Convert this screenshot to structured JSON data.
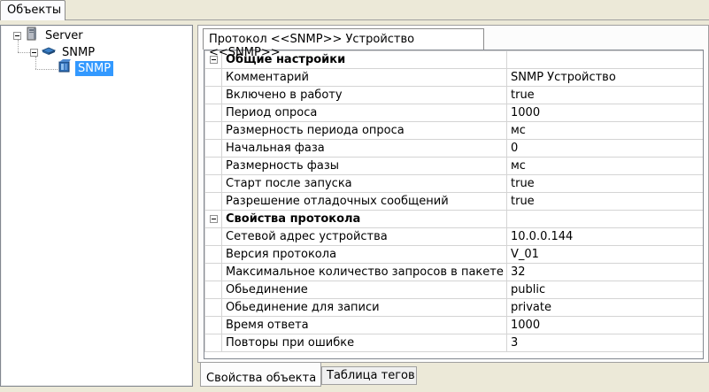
{
  "top_tab": {
    "label": "Объекты"
  },
  "tree": {
    "root": {
      "label": "Server",
      "icon": "server-icon"
    },
    "child": {
      "label": "SNMP",
      "icon": "network-icon"
    },
    "leaf": {
      "label": "SNMP",
      "icon": "device-icon",
      "selected": true
    }
  },
  "protocol_tab": {
    "label": "Протокол <<SNMP>> Устройство <<SNMP>>"
  },
  "properties": {
    "general": {
      "title": "Общие настройки",
      "rows": [
        {
          "key": "Комментарий",
          "value": "SNMP Устройство"
        },
        {
          "key": "Включено в работу",
          "value": "true"
        },
        {
          "key": "Период опроса",
          "value": "1000"
        },
        {
          "key": "Размерность периода опроса",
          "value": "мс"
        },
        {
          "key": "Начальная фаза",
          "value": "0"
        },
        {
          "key": "Размерность фазы",
          "value": "мс"
        },
        {
          "key": "Старт после запуска",
          "value": "true"
        },
        {
          "key": "Разрешение отладочных сообщений",
          "value": "true"
        }
      ]
    },
    "protocol": {
      "title": "Свойства протокола",
      "rows": [
        {
          "key": "Сетевой адрес устройства",
          "value": "10.0.0.144"
        },
        {
          "key": "Версия протокола",
          "value": "V_01"
        },
        {
          "key": "Максимальное количество запросов в пакете",
          "value": "32"
        },
        {
          "key": "Обьединение",
          "value": "public"
        },
        {
          "key": "Обьединение для записи",
          "value": "private"
        },
        {
          "key": "Время ответа",
          "value": "1000"
        },
        {
          "key": "Повторы при ошибке",
          "value": "3"
        }
      ]
    }
  },
  "bottom_tabs": {
    "object_props": "Свойства объекта",
    "tags_table": "Таблица тегов"
  }
}
